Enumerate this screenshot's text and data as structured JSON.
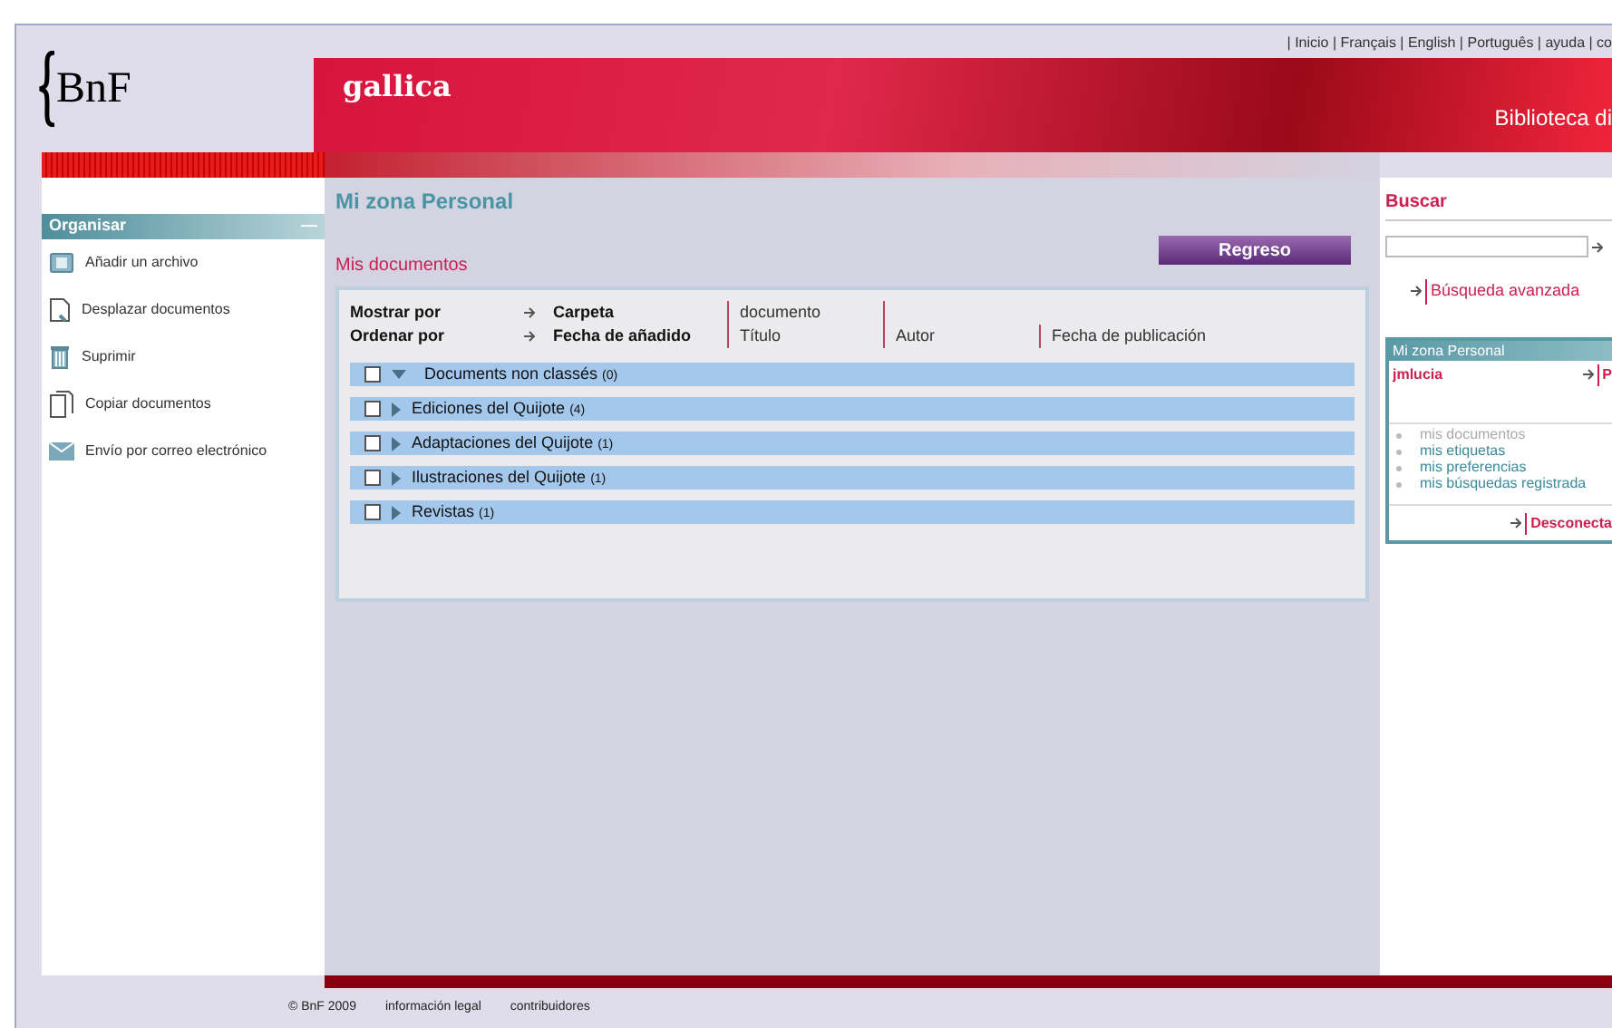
{
  "header": {
    "logo": "BnF",
    "brand": "gallica",
    "top_links": "| Inicio | Français | English | Português | ayuda | co",
    "tagline": "Biblioteca di"
  },
  "sidebar": {
    "title": "Organisar",
    "collapse": "—",
    "items": [
      {
        "kind": "add",
        "label": "Añadir un archivo"
      },
      {
        "kind": "move",
        "label": "Desplazar documentos"
      },
      {
        "kind": "delete",
        "label": "Suprimir"
      },
      {
        "kind": "copy",
        "label": "Copiar documentos"
      },
      {
        "kind": "mail",
        "label": "Envío por correo electrónico"
      }
    ]
  },
  "main": {
    "title": "Mi zona Personal",
    "subtitle": "Mis documentos",
    "back_button": "Regreso",
    "show_by": {
      "label": "Mostrar por",
      "options": [
        {
          "label": "Carpeta",
          "selected": true
        },
        {
          "label": "documento",
          "selected": false
        }
      ]
    },
    "sort_by": {
      "label": "Ordenar por",
      "options": [
        {
          "label": "Fecha de añadido",
          "selected": true
        },
        {
          "label": "Título",
          "selected": false
        },
        {
          "label": "Autor",
          "selected": false
        },
        {
          "label": "Fecha de publicación",
          "selected": false
        }
      ]
    },
    "folders": [
      {
        "name": "Documents non classés",
        "count": "(0)",
        "expanded": true,
        "checked": false
      },
      {
        "name": "Ediciones del Quijote",
        "count": "(4)",
        "expanded": false,
        "checked": false
      },
      {
        "name": "Adaptaciones del Quijote",
        "count": "(1)",
        "expanded": false,
        "checked": false
      },
      {
        "name": "Ilustraciones del Quijote",
        "count": "(1)",
        "expanded": false,
        "checked": false
      },
      {
        "name": "Revistas",
        "count": "(1)",
        "expanded": false,
        "checked": false
      }
    ]
  },
  "right": {
    "search_title": "Buscar",
    "advanced": "Búsqueda avanzada",
    "panel_title": "Mi zona Personal",
    "user": "jmlucia",
    "user_link": "P",
    "links": [
      {
        "label": "mis documentos",
        "selected": true
      },
      {
        "label": "mis etiquetas",
        "selected": false
      },
      {
        "label": "mis preferencias",
        "selected": false
      },
      {
        "label": "mis búsquedas registrada",
        "selected": false
      }
    ],
    "logout": "Desconecta"
  },
  "footer": [
    "© BnF 2009",
    "información legal",
    "contribuidores"
  ]
}
